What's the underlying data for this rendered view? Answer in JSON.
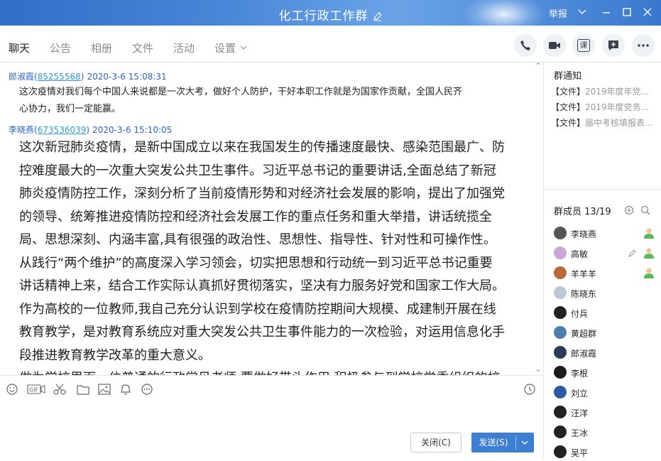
{
  "window": {
    "title": "化工行政工作群",
    "report_label": "举报",
    "colors": {
      "titlebar": "#3a78cf",
      "accent": "#2d6fcf",
      "send": "#3f7fd3"
    }
  },
  "tabs": [
    {
      "label": "聊天",
      "active": true
    },
    {
      "label": "公告"
    },
    {
      "label": "相册"
    },
    {
      "label": "文件"
    },
    {
      "label": "活动"
    },
    {
      "label": "设置"
    }
  ],
  "toolbar": {
    "lesson_label": "课"
  },
  "messages": [
    {
      "sender": "郎淑霞",
      "qq": "85255568",
      "time": "2020-3-6 15:08:31",
      "lines": [
        "这次疫情对我们每个中国人来说都是一次大考，做好个人防护，干好本职工作就是为国家作贡献，全国人民齐",
        "心协力，我们一定能赢。"
      ]
    },
    {
      "sender": "李晓燕",
      "qq": "673536039",
      "time": "2020-3-6 15:10:05",
      "lines": [
        "这次新冠肺炎疫情，是新中国成立以来在我国发生的传播速度最快、感染范围最广、防",
        "控难度最大的一次重大突发公共卫生事件。习近平总书记的重要讲话,全面总结了新冠",
        "肺炎疫情防控工作，深刻分析了当前疫情形势和对经济社会发展的影响，提出了加强党",
        "的领导、统筹推进疫情防控和经济社会发展工作的重点任务和重大举措，讲话统揽全",
        "局、思想深刻、内涵丰富,具有很强的政治性、思想性、指导性、针对性和可操作性。",
        "从践行“两个维护”的高度深入学习领会，切实把思想和行动统一到习近平总书记重要",
        "讲话精神上来，结合工作实际认真抓好贯彻落实，坚决有力服务好党和国家工作大局。",
        "作为高校的一位教师,我自己充分认识到学校在疫情防控期间大规模、成建制开展在线",
        "教育教学，是对教育系统应对重大突发公共卫生事件能力的一次检验，对运用信息化手",
        "段推进教育教学改革的重大意义。",
        "做为学校里面一位普通的行政常见老师,要做好带头作用,积极参与到学校党委组织的校"
      ]
    }
  ],
  "notice": {
    "title": "群通知",
    "items": [
      {
        "tag": "【文件】",
        "text": "2019年度年党..."
      },
      {
        "tag": "【文件】",
        "text": "2019年度党务..."
      },
      {
        "tag": "【文件】",
        "text": "届中考核填报表..."
      }
    ]
  },
  "members": {
    "title": "群成员 13/19",
    "list": [
      {
        "name": "李晓燕",
        "color": "#555555",
        "role": "admin"
      },
      {
        "name": "高敏",
        "color": "#c9a5d8",
        "role": "admin",
        "editable": true
      },
      {
        "name": "羊羊羊",
        "color": "#b86a3a",
        "role": "admin"
      },
      {
        "name": "陈晓东",
        "color": "#b9c7d6"
      },
      {
        "name": "付兵",
        "color": "#222222"
      },
      {
        "name": "黄超群",
        "color": "#4d7fae"
      },
      {
        "name": "郎淑霞",
        "color": "#2a3c5c"
      },
      {
        "name": "李根",
        "color": "#1c1c1c"
      },
      {
        "name": "刘立",
        "color": "#2a5aa8"
      },
      {
        "name": "汪洋",
        "color": "#222222"
      },
      {
        "name": "王冰",
        "color": "#222222"
      },
      {
        "name": "吴平",
        "color": "#222222"
      }
    ]
  },
  "input": {
    "close_label": "关闭(C)",
    "send_label": "发送(S)"
  }
}
